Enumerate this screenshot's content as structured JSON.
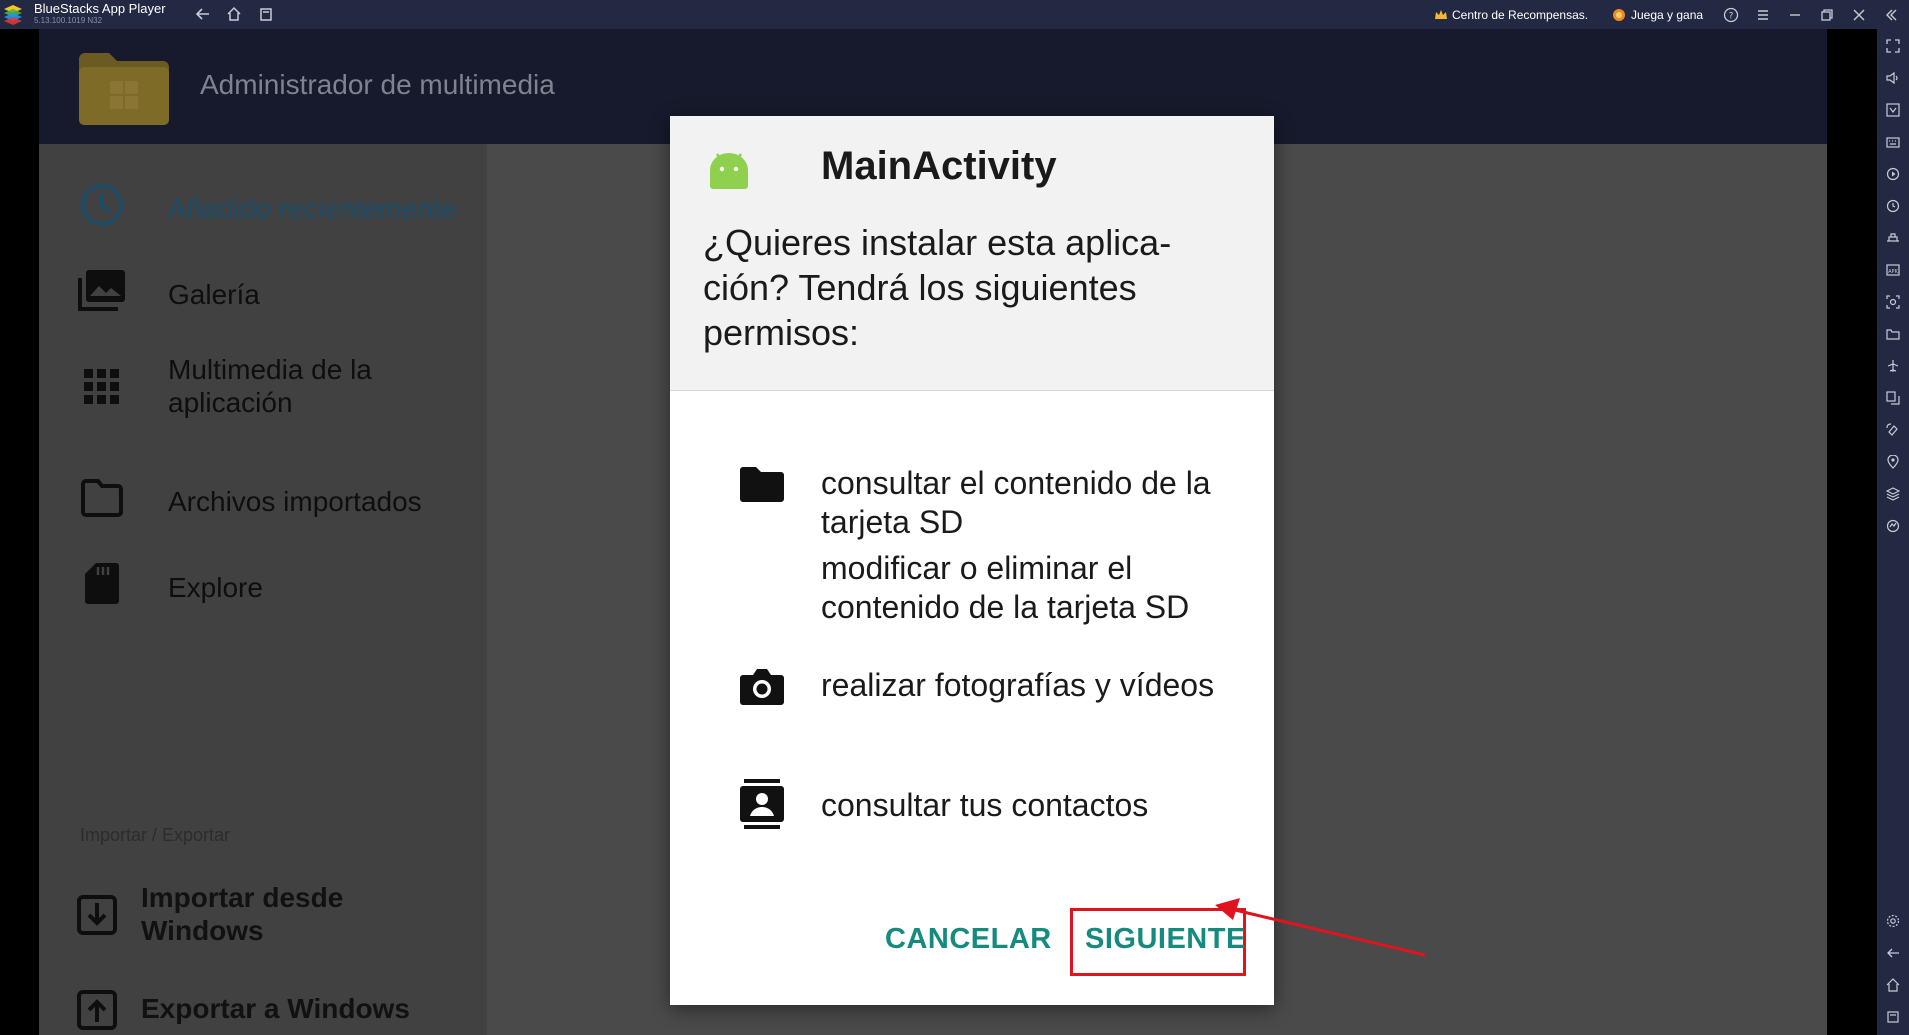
{
  "window": {
    "title": "BlueStacks App Player",
    "version": "5.13.100.1019  N32",
    "rewards_label": "Centro de Recompensas.",
    "play_label": "Juega y gana"
  },
  "app": {
    "header_title": "Administrador de multimedia",
    "nav_items": [
      {
        "label": "Añadido recientemente",
        "icon": "clock-icon",
        "active": true
      },
      {
        "label": "Galería",
        "icon": "gallery-icon"
      },
      {
        "label": "Multimedia de la aplicación",
        "icon": "grid-icon"
      },
      {
        "label": "Archivos importados",
        "icon": "folder-outline-icon"
      },
      {
        "label": "Explore",
        "icon": "sd-card-icon"
      }
    ],
    "section_label": "Importar / Exportar",
    "io_items": [
      {
        "label": "Importar desde Windows",
        "icon": "import-icon"
      },
      {
        "label": "Exportar a Windows",
        "icon": "export-icon"
      }
    ]
  },
  "dialog": {
    "title": "MainActivity",
    "question": "¿Quieres instalar esta aplica-ción? Tendrá los siguientes permisos:",
    "permissions": [
      {
        "icon": "folder-icon",
        "lines": [
          "consultar el contenido de la tarjeta SD",
          "modificar o eliminar el contenido de la tarjeta SD"
        ]
      },
      {
        "icon": "camera-icon",
        "lines": [
          "realizar fotografías y vídeos"
        ]
      },
      {
        "icon": "contacts-icon",
        "lines": [
          "consultar tus contactos"
        ]
      }
    ],
    "cancel_label": "CANCELAR",
    "next_label": "SIGUIENTE"
  },
  "colors": {
    "accent": "#158a7e",
    "highlight": "#e0141e",
    "titlebar": "#232843"
  }
}
